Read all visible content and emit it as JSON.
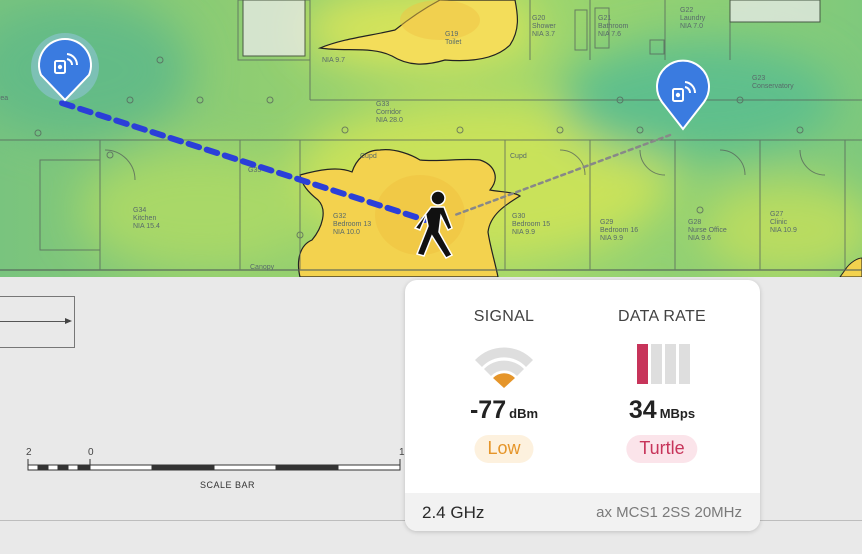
{
  "map": {
    "rooms": [
      {
        "code": "G20",
        "name": "Shower",
        "nia": "NIA 3.7"
      },
      {
        "code": "G21",
        "name": "Bathroom",
        "nia": "NIA 7.6"
      },
      {
        "code": "G22",
        "name": "Laundry",
        "nia": "NIA 7.0"
      },
      {
        "code": "G19",
        "name": "Toilet",
        "nia": ""
      },
      {
        "code": "G23",
        "name": "Conservatory",
        "nia": ""
      },
      {
        "code": "G33",
        "name": "Corridor",
        "nia": "NIA 28.0"
      },
      {
        "code": "G34",
        "name": "Kitchen",
        "nia": "NIA 15.4"
      },
      {
        "code": "G32",
        "name": "Bedroom 13",
        "nia": "NIA 10.0"
      },
      {
        "code": "G30",
        "name": "Bedroom 15",
        "nia": "NIA 9.9"
      },
      {
        "code": "G29",
        "name": "Bedroom 16",
        "nia": "NIA 9.9"
      },
      {
        "code": "G28",
        "name": "Nurse Office",
        "nia": "NIA 9.6"
      },
      {
        "code": "G27",
        "name": "Clinic",
        "nia": "NIA 10.9"
      }
    ],
    "misc_labels": {
      "area": "rea",
      "nia_97": "NIA 9.7",
      "canopy": "Canopy",
      "cupd_a": "Cupd",
      "cupd_b": "Cupd",
      "g35": "G35"
    }
  },
  "access_points": [
    {
      "name": "access-point-connected",
      "icon": "wifi-access-point-icon",
      "color": "#3a7be0"
    },
    {
      "name": "access-point-other",
      "icon": "wifi-access-point-icon",
      "color": "#3a7be0"
    }
  ],
  "scale_bar": {
    "left_num": "2",
    "zero": "0",
    "right_num": "1",
    "label": "SCALE BAR"
  },
  "signal_card": {
    "signal": {
      "title": "SIGNAL",
      "value": "-77",
      "unit": "dBm",
      "quality": "Low",
      "level_bars_filled": 1,
      "level_bars_total": 3,
      "color": "#e5952a"
    },
    "data_rate": {
      "title": "DATA RATE",
      "value": "34",
      "unit": "MBps",
      "quality": "Turtle",
      "level_bars_filled": 1,
      "level_bars_total": 4,
      "color": "#c7345a"
    },
    "footer": {
      "band": "2.4 GHz",
      "mcs": "ax MCS1 2SS 20MHz"
    }
  }
}
